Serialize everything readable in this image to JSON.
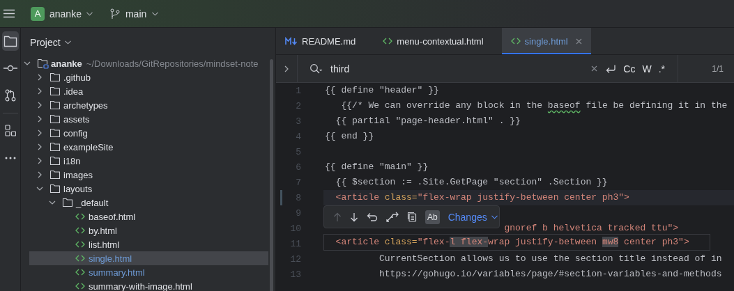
{
  "top_bar": {
    "project": {
      "initial": "A",
      "name": "ananke"
    },
    "branch": "main"
  },
  "tool_strip": [
    {
      "kind": "project",
      "selected": true
    },
    {
      "kind": "commit",
      "selected": false
    },
    {
      "kind": "pull-requests",
      "selected": false
    },
    {
      "kind": "divider"
    },
    {
      "kind": "structure",
      "selected": false
    },
    {
      "kind": "more",
      "selected": false
    }
  ],
  "project_panel": {
    "title": "Project",
    "tree": [
      {
        "kind": "project",
        "name": "ananke",
        "path": "~/Downloads/GitRepositories/mindset-note",
        "expanded": true,
        "selected": false,
        "children": [
          {
            "kind": "folder",
            "name": ".github",
            "expanded": false,
            "selected": false
          },
          {
            "kind": "folder",
            "name": ".idea",
            "expanded": false,
            "selected": false
          },
          {
            "kind": "folder",
            "name": "archetypes",
            "expanded": false,
            "selected": false
          },
          {
            "kind": "folder",
            "name": "assets",
            "expanded": false,
            "selected": false
          },
          {
            "kind": "folder",
            "name": "config",
            "expanded": false,
            "selected": false
          },
          {
            "kind": "folder",
            "name": "exampleSite",
            "expanded": false,
            "selected": false
          },
          {
            "kind": "folder",
            "name": "i18n",
            "expanded": false,
            "selected": false
          },
          {
            "kind": "folder",
            "name": "images",
            "expanded": false,
            "selected": false
          },
          {
            "kind": "folder",
            "name": "layouts",
            "expanded": true,
            "selected": false,
            "children": [
              {
                "kind": "folder",
                "name": "_default",
                "expanded": true,
                "selected": false,
                "children": [
                  {
                    "kind": "html-file",
                    "name": "baseof.html",
                    "modified": false,
                    "selected": false
                  },
                  {
                    "kind": "html-file",
                    "name": "by.html",
                    "modified": false,
                    "selected": false
                  },
                  {
                    "kind": "html-file",
                    "name": "list.html",
                    "modified": false,
                    "selected": false
                  },
                  {
                    "kind": "html-file",
                    "name": "single.html",
                    "modified": true,
                    "selected": true
                  },
                  {
                    "kind": "html-file",
                    "name": "summary.html",
                    "modified": true,
                    "selected": false
                  },
                  {
                    "kind": "html-file",
                    "name": "summary-with-image.html",
                    "modified": false,
                    "selected": false
                  }
                ]
              }
            ]
          }
        ]
      }
    ]
  },
  "editor": {
    "tabs": [
      {
        "kind": "markdown",
        "label": "README.md",
        "modified": false,
        "selected": false,
        "closable": false
      },
      {
        "kind": "html",
        "label": "menu-contextual.html",
        "modified": false,
        "selected": false,
        "closable": false
      },
      {
        "kind": "html",
        "label": "single.html",
        "modified": true,
        "selected": true,
        "closable": true
      }
    ],
    "search": {
      "value": "third",
      "options": [
        "Cc",
        "W",
        ".*"
      ],
      "match_count": "1/1"
    },
    "lines": [
      {
        "number": "1",
        "current": false,
        "changed": false,
        "segments": [
          {
            "kind": "plain",
            "text": "{{ define \"header\" }}"
          }
        ]
      },
      {
        "number": "2",
        "current": false,
        "changed": false,
        "segments": [
          {
            "kind": "plain",
            "text": "   {{/* We can override any block in the "
          },
          {
            "kind": "typo",
            "text": "baseof"
          },
          {
            "kind": "plain",
            "text": " file be defining it in the"
          }
        ]
      },
      {
        "number": "3",
        "current": false,
        "changed": false,
        "segments": [
          {
            "kind": "plain",
            "text": "  {{ partial \"page-header.html\" . }}"
          }
        ]
      },
      {
        "number": "4",
        "current": false,
        "changed": false,
        "segments": [
          {
            "kind": "plain",
            "text": "{{ end }}"
          }
        ]
      },
      {
        "number": "5",
        "current": false,
        "changed": false
      },
      {
        "number": "6",
        "current": false,
        "changed": false,
        "segments": [
          {
            "kind": "plain",
            "text": "{{ define \"main\" }}"
          }
        ]
      },
      {
        "number": "7",
        "current": false,
        "changed": false,
        "segments": [
          {
            "kind": "plain",
            "text": "  {{ $section := .Site.GetPage \"section\" .Section }}"
          }
        ]
      },
      {
        "number": "8",
        "current": true,
        "changed": true,
        "segments": [
          {
            "kind": "tag",
            "text": "  <article"
          },
          {
            "kind": "attr",
            "text": " class="
          },
          {
            "kind": "string",
            "text": "\"flex-wrap justify-between center ph3\""
          },
          {
            "kind": "tag",
            "text": ">"
          }
        ]
      },
      {
        "number": "9",
        "current": false,
        "changed": false
      },
      {
        "number": "10",
        "current": false,
        "changed": false,
        "segments": [
          {
            "kind": "string",
            "text": "                                 gnoref b helvetica tracked ttu\""
          },
          {
            "kind": "tag",
            "text": ">"
          }
        ]
      },
      {
        "number": "11",
        "current": false,
        "changed": false
      },
      {
        "number": "12",
        "current": false,
        "changed": false,
        "segments": [
          {
            "kind": "plain",
            "text": "          CurrentSection allows us to use the section title instead of in"
          }
        ]
      },
      {
        "number": "13",
        "current": false,
        "changed": false,
        "segments": [
          {
            "kind": "plain",
            "text": "          https://gohugo.io/variables/page/#section-variables-and-methods"
          }
        ]
      }
    ],
    "diff_popup": {
      "actions": [
        {
          "kind": "up",
          "disabled": true
        },
        {
          "kind": "down",
          "disabled": false
        },
        {
          "kind": "revert",
          "disabled": false
        },
        {
          "kind": "compare",
          "disabled": false
        },
        {
          "kind": "copy",
          "disabled": false
        }
      ],
      "highlight_toggle": {
        "label": "Ab",
        "on": true
      },
      "menu_label": "Changes",
      "old_line": [
        {
          "kind": "tag",
          "text": "  <article"
        },
        {
          "kind": "attr",
          "text": " class="
        },
        {
          "kind": "string",
          "text": "\"flex-"
        },
        {
          "kind": "changed",
          "text": "l flex-"
        },
        {
          "kind": "string",
          "text": "wrap justify-between "
        },
        {
          "kind": "changed",
          "text": "mw8"
        },
        {
          "kind": "string",
          "text": " center ph3\""
        },
        {
          "kind": "tag",
          "text": ">"
        }
      ]
    }
  }
}
